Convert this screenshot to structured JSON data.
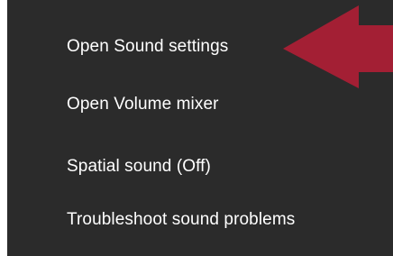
{
  "context_menu": {
    "items": [
      {
        "label": "Open Sound settings"
      },
      {
        "label": "Open Volume mixer"
      },
      {
        "label": "Spatial sound (Off)"
      },
      {
        "label": "Troubleshoot sound problems"
      }
    ]
  },
  "annotation": {
    "arrow_color": "#a31f34",
    "icon": "left-arrow-icon"
  },
  "colors": {
    "menu_background": "#2b2b2b",
    "text": "#ffffff"
  }
}
